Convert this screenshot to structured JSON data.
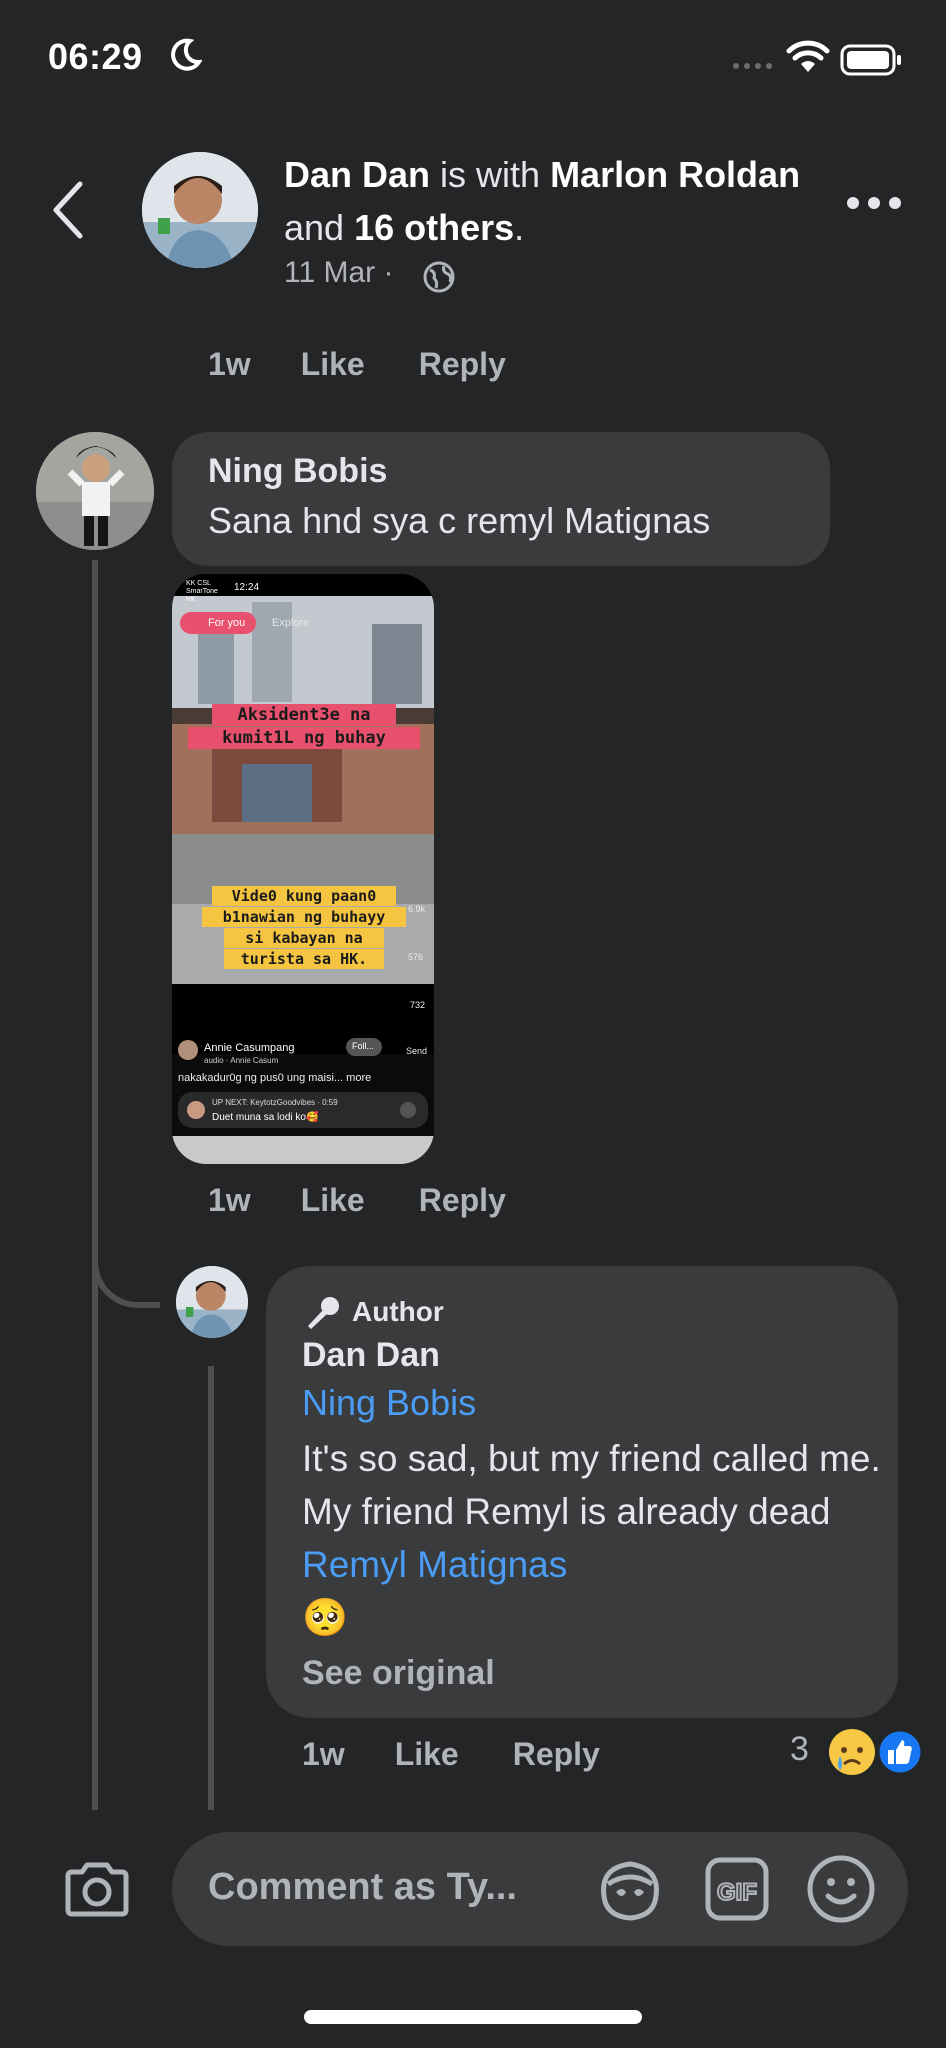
{
  "status_bar": {
    "time": "06:29"
  },
  "header": {
    "author": "Dan Dan",
    "is_with": " is with ",
    "tagged": "Marlon Roldan",
    "and": " and ",
    "others": "16 others",
    "period": ".",
    "date": "11 Mar",
    "sep": "·"
  },
  "actions": {
    "age": "1w",
    "like": "Like",
    "reply": "Reply"
  },
  "comment1": {
    "name": "Ning Bobis",
    "text": "Sana hnd sya c remyl Matignas",
    "media": {
      "carrier": "KK CSL SmarTone HK",
      "clock": "12:24",
      "tab_for_you": "For you",
      "tab_explore": "Explore",
      "caption_top_1": "Aksident3e na",
      "caption_top_2": "kumit1L ng buhay",
      "caption_mid_1": "Vide0 kung paan0",
      "caption_mid_2": "b1nawian ng buhayy",
      "caption_mid_3": "si kabayan na",
      "caption_mid_4": "turista sa HK.",
      "likes": "6.9k",
      "comments": "576",
      "shares": "732",
      "send": "Send",
      "user": "Annie Casumpang",
      "follow": "Foll...",
      "audio": "audio · Annie Casum",
      "desc": "nakakadur0g ng pus0 ung maisi... more",
      "up_next": "UP NEXT: KeytotzGoodvibes · 0:59",
      "up_next_title": "Duet muna sa lodi ko🥰"
    }
  },
  "reply": {
    "badge": "Author",
    "name": "Dan Dan",
    "mention": "Ning Bobis",
    "text": "It's so sad, but my friend called me. My friend Remyl is already dead ",
    "mention2": "Remyl Matignas",
    "emoji": "🥺",
    "see_original": "See original",
    "reaction_count": "3"
  },
  "composer": {
    "placeholder": "Comment as Ty..."
  },
  "colors": {
    "background": "#242526",
    "bubble": "#3a3b3c",
    "link": "#4a9cf5",
    "muted": "#b0b3b8"
  },
  "icons": [
    "moon-icon",
    "signal-icon",
    "wifi-icon",
    "battery-icon",
    "back-icon",
    "globe-icon",
    "more-icon",
    "microphone-icon",
    "sad-reaction-icon",
    "like-reaction-icon",
    "camera-icon",
    "avatar-sticker-icon",
    "gif-icon",
    "emoji-icon"
  ]
}
